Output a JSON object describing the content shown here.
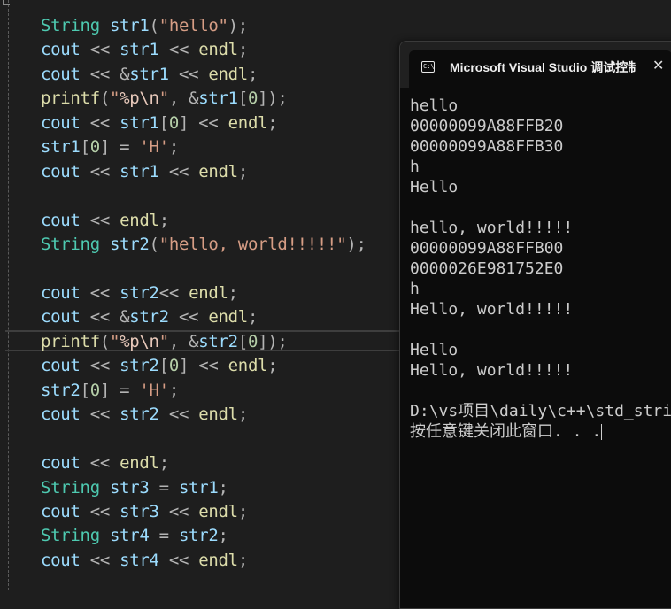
{
  "editor": {
    "lines": [
      {
        "parts": [
          [
            "String",
            "type"
          ],
          [
            " ",
            "op"
          ],
          [
            "str1",
            "var"
          ],
          [
            "(",
            "punct"
          ],
          [
            "\"hello\"",
            "str"
          ],
          [
            ");",
            "punct"
          ]
        ]
      },
      {
        "parts": [
          [
            "cout",
            "var"
          ],
          [
            " << ",
            "op"
          ],
          [
            "str1",
            "var"
          ],
          [
            " << ",
            "op"
          ],
          [
            "endl",
            "fn"
          ],
          [
            ";",
            "punct"
          ]
        ]
      },
      {
        "parts": [
          [
            "cout",
            "var"
          ],
          [
            " << ",
            "op"
          ],
          [
            "&",
            "op"
          ],
          [
            "str1",
            "var"
          ],
          [
            " << ",
            "op"
          ],
          [
            "endl",
            "fn"
          ],
          [
            ";",
            "punct"
          ]
        ]
      },
      {
        "parts": [
          [
            "printf",
            "fn"
          ],
          [
            "(",
            "punct"
          ],
          [
            "\"",
            "str"
          ],
          [
            "%p\\n",
            "esc"
          ],
          [
            "\"",
            "str"
          ],
          [
            ", ",
            "punct"
          ],
          [
            "&",
            "op"
          ],
          [
            "str1",
            "var"
          ],
          [
            "[",
            "punct"
          ],
          [
            "0",
            "num"
          ],
          [
            "]);",
            "punct"
          ]
        ]
      },
      {
        "parts": [
          [
            "cout",
            "var"
          ],
          [
            " << ",
            "op"
          ],
          [
            "str1",
            "var"
          ],
          [
            "[",
            "punct"
          ],
          [
            "0",
            "num"
          ],
          [
            "]",
            "punct"
          ],
          [
            " << ",
            "op"
          ],
          [
            "endl",
            "fn"
          ],
          [
            ";",
            "punct"
          ]
        ]
      },
      {
        "parts": [
          [
            "str1",
            "var"
          ],
          [
            "[",
            "punct"
          ],
          [
            "0",
            "num"
          ],
          [
            "]",
            "punct"
          ],
          [
            " = ",
            "op"
          ],
          [
            "'H'",
            "str"
          ],
          [
            ";",
            "punct"
          ]
        ]
      },
      {
        "parts": [
          [
            "cout",
            "var"
          ],
          [
            " << ",
            "op"
          ],
          [
            "str1",
            "var"
          ],
          [
            " << ",
            "op"
          ],
          [
            "endl",
            "fn"
          ],
          [
            ";",
            "punct"
          ]
        ]
      },
      {
        "parts": []
      },
      {
        "parts": [
          [
            "cout",
            "var"
          ],
          [
            " << ",
            "op"
          ],
          [
            "endl",
            "fn"
          ],
          [
            ";",
            "punct"
          ]
        ]
      },
      {
        "parts": [
          [
            "String",
            "type"
          ],
          [
            " ",
            "op"
          ],
          [
            "str2",
            "var"
          ],
          [
            "(",
            "punct"
          ],
          [
            "\"hello, world!!!!!\"",
            "str"
          ],
          [
            ");",
            "punct"
          ]
        ]
      },
      {
        "parts": []
      },
      {
        "parts": [
          [
            "cout",
            "var"
          ],
          [
            " << ",
            "op"
          ],
          [
            "str2",
            "var"
          ],
          [
            "<< ",
            "op"
          ],
          [
            "endl",
            "fn"
          ],
          [
            ";",
            "punct"
          ]
        ]
      },
      {
        "parts": [
          [
            "cout",
            "var"
          ],
          [
            " << ",
            "op"
          ],
          [
            "&",
            "op"
          ],
          [
            "str2",
            "var"
          ],
          [
            " << ",
            "op"
          ],
          [
            "endl",
            "fn"
          ],
          [
            ";",
            "punct"
          ]
        ]
      },
      {
        "parts": [
          [
            "printf",
            "fn"
          ],
          [
            "(",
            "punct"
          ],
          [
            "\"",
            "str"
          ],
          [
            "%p\\n",
            "esc"
          ],
          [
            "\"",
            "str"
          ],
          [
            ", ",
            "punct"
          ],
          [
            "&",
            "op"
          ],
          [
            "str2",
            "var"
          ],
          [
            "[",
            "punct"
          ],
          [
            "0",
            "num"
          ],
          [
            "]);",
            "punct"
          ]
        ]
      },
      {
        "parts": [
          [
            "cout",
            "var"
          ],
          [
            " << ",
            "op"
          ],
          [
            "str2",
            "var"
          ],
          [
            "[",
            "punct"
          ],
          [
            "0",
            "num"
          ],
          [
            "]",
            "punct"
          ],
          [
            " << ",
            "op"
          ],
          [
            "endl",
            "fn"
          ],
          [
            ";",
            "punct"
          ]
        ]
      },
      {
        "parts": [
          [
            "str2",
            "var"
          ],
          [
            "[",
            "punct"
          ],
          [
            "0",
            "num"
          ],
          [
            "]",
            "punct"
          ],
          [
            " = ",
            "op"
          ],
          [
            "'H'",
            "str"
          ],
          [
            ";",
            "punct"
          ]
        ]
      },
      {
        "parts": [
          [
            "cout",
            "var"
          ],
          [
            " << ",
            "op"
          ],
          [
            "str2",
            "var"
          ],
          [
            " << ",
            "op"
          ],
          [
            "endl",
            "fn"
          ],
          [
            ";",
            "punct"
          ]
        ]
      },
      {
        "parts": []
      },
      {
        "parts": [
          [
            "cout",
            "var"
          ],
          [
            " << ",
            "op"
          ],
          [
            "endl",
            "fn"
          ],
          [
            ";",
            "punct"
          ]
        ]
      },
      {
        "parts": [
          [
            "String",
            "type"
          ],
          [
            " ",
            "op"
          ],
          [
            "str3",
            "var"
          ],
          [
            " = ",
            "op"
          ],
          [
            "str1",
            "var"
          ],
          [
            ";",
            "punct"
          ]
        ]
      },
      {
        "parts": [
          [
            "cout",
            "var"
          ],
          [
            " << ",
            "op"
          ],
          [
            "str3",
            "var"
          ],
          [
            " << ",
            "op"
          ],
          [
            "endl",
            "fn"
          ],
          [
            ";",
            "punct"
          ]
        ]
      },
      {
        "parts": [
          [
            "String",
            "type"
          ],
          [
            " ",
            "op"
          ],
          [
            "str4",
            "var"
          ],
          [
            " = ",
            "op"
          ],
          [
            "str2",
            "var"
          ],
          [
            ";",
            "punct"
          ]
        ]
      },
      {
        "parts": [
          [
            "cout",
            "var"
          ],
          [
            " << ",
            "op"
          ],
          [
            "str4",
            "var"
          ],
          [
            " << ",
            "op"
          ],
          [
            "endl",
            "fn"
          ],
          [
            ";",
            "punct"
          ]
        ]
      }
    ]
  },
  "console": {
    "icon": "console-icon",
    "icon_glyph": "C:\\",
    "title": "Microsoft Visual Studio 调试控制台",
    "close_glyph": "✕",
    "output": [
      "hello",
      "00000099A88FFB20",
      "00000099A88FFB30",
      "h",
      "Hello",
      "",
      "hello, world!!!!!",
      "00000099A88FFB00",
      "0000026E981752E0",
      "h",
      "Hello, world!!!!!",
      "",
      "Hello",
      "Hello, world!!!!!",
      "",
      "D:\\vs项目\\daily\\c++\\std_string",
      "按任意键关闭此窗口. . ."
    ]
  }
}
